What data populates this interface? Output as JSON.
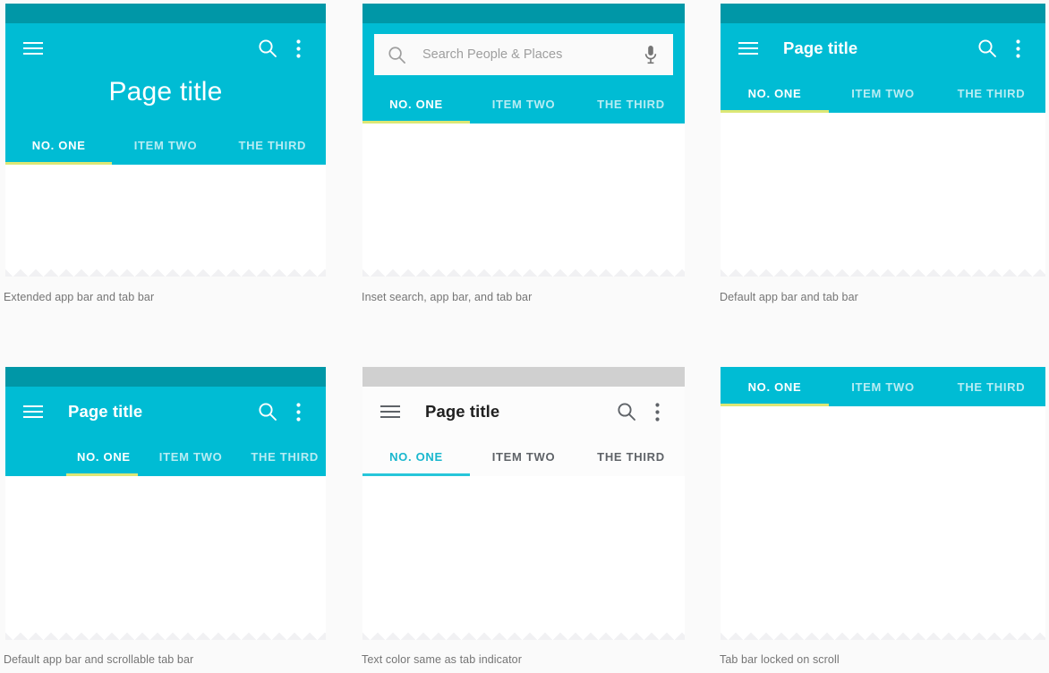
{
  "theme": {
    "page_background": "#fafafa",
    "statusbar_color": "#0097a7",
    "statusbar_grey": "#d0d0d0",
    "appbar_color": "#00bcd4",
    "appbar_light": "#fcfcfc",
    "indicator_yellow": "#dce775",
    "indicator_teal": "#26c6da",
    "caption_color": "#757575",
    "active_tab_light_color": "#1ab7ce"
  },
  "common": {
    "page_title": "Page title",
    "tabs": [
      "NO. ONE",
      "ITEM TWO",
      "THE THIRD"
    ],
    "icons": {
      "menu": "hamburger-menu-icon",
      "search": "search-icon",
      "overflow": "overflow-menu-icon",
      "mic": "microphone-icon"
    }
  },
  "panels": [
    {
      "id": "extended-app-bar",
      "caption": "Extended app bar and tab bar",
      "title": "Page title",
      "tabs": [
        "NO. ONE",
        "ITEM TWO",
        "THE THIRD"
      ],
      "active_tab_index": 0
    },
    {
      "id": "inset-search",
      "caption": "Inset search, app bar, and tab bar",
      "search_placeholder": "Search People  & Places",
      "search_value": "",
      "tabs": [
        "NO. ONE",
        "ITEM TWO",
        "THE THIRD"
      ],
      "active_tab_index": 0
    },
    {
      "id": "default-app-bar",
      "caption": "Default app bar and tab bar",
      "title": "Page title",
      "tabs": [
        "NO. ONE",
        "ITEM TWO",
        "THE THIRD"
      ],
      "active_tab_index": 0
    },
    {
      "id": "scrollable-tab-bar",
      "caption": "Default app bar and scrollable tab bar",
      "title": "Page title",
      "tabs": [
        "NO. ONE",
        "ITEM TWO",
        "THE THIRD"
      ],
      "active_tab_index": 0
    },
    {
      "id": "light-app-bar",
      "caption": "Text color same as tab indicator",
      "title": "Page title",
      "tabs": [
        "NO. ONE",
        "ITEM TWO",
        "THE THIRD"
      ],
      "active_tab_index": 0
    },
    {
      "id": "tab-bar-locked",
      "caption": "Tab bar locked on scroll",
      "tabs": [
        "NO. ONE",
        "ITEM TWO",
        "THE THIRD"
      ],
      "active_tab_index": 0
    }
  ]
}
